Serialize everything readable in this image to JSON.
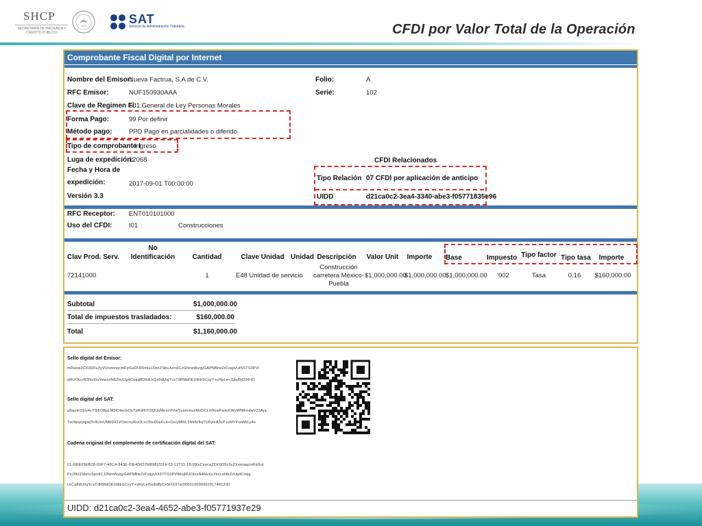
{
  "header": {
    "shcp_title": "SHCP",
    "shcp_sub": "SECRETARÍA DE HACIENDA Y CRÉDITO PÚBLICO",
    "sat_name": "SAT",
    "sat_sub": "Servicio de Administración Tributaria",
    "slide_title": "CFDI por Valor Total de la Operación"
  },
  "invoice": {
    "panel_title": "Comprobante Fiscal Digital por Internet",
    "emisor": {
      "nombre_label": "Nombre del Emisor:",
      "nombre_value": "Nueva Factrua, S.A de C.V.",
      "rfc_label": "RFC Emisor:",
      "rfc_value": "NUF150930AAA",
      "regimen_label": "Clave de Regimen Fi:",
      "regimen_value": "601,General de Ley Personas Morales",
      "forma_label": "Forma Pago:",
      "forma_value": "99 Por definir",
      "metodo_label": "Método pago:",
      "metodo_value": "PPD Pago en parcialidades o diferido",
      "tipo_label": "Tipo de comprobante I",
      "tipo_value": "Ingreso",
      "lugar_label": "Luga de expedición:",
      "lugar_value": "12068",
      "fecha_label1": "Fecha y Hora de",
      "fecha_label2": "expedición:",
      "fecha_value": "2017-09-01 T00:00:00",
      "version_label": "Versión 3.3"
    },
    "folio_label": "Folio:",
    "folio_value": "A",
    "serie_label": "Serie:",
    "serie_value": "102",
    "relacionados": {
      "title": "CFDI Relacionados",
      "tipo_label": "Tipo Relación",
      "tipo_value": "07 CFDI por aplicación de anticipo",
      "uidd_label": "UIDD",
      "uidd_value": "d21ca0c2-3ea4-3340-abe3-f05771835e96"
    },
    "receptor": {
      "rfc_label": "RFC Receptor:",
      "rfc_value": "ENT010101000",
      "uso_label": "Uso del CFDI:",
      "uso_code": "I01",
      "uso_value": "Construcciones"
    },
    "concepts": {
      "headers": [
        "Clav Prod. Serv.",
        "No",
        "Identificación",
        "Cantidad",
        "Clave Unidad",
        "Unidad",
        "Descripción",
        "Valor Unit",
        "Importe",
        "Base",
        "Impuesto",
        "Tipo factor",
        "Tipo tasa",
        "Importe"
      ],
      "row": {
        "clave": "72141000",
        "cantidad": "1",
        "clave_unidad": "E48 Unidad de servicio",
        "desc1": "Construcción",
        "desc2": "carretera México-",
        "desc3": "Puebla",
        "valor_unit": "$1,000,000.00",
        "importe": "$1,000,000.00",
        "base": "$1,000,000.00",
        "impuesto": "'002",
        "tipo_factor": "Tasa",
        "tipo_tasa": "0.16",
        "importe_imp": "$160,000.00"
      }
    },
    "totals": {
      "subtotal_label": "Subtotal",
      "subtotal_value": "$1,000,000.00",
      "impuestos_label": "Total de impuestos trasladados:",
      "impuestos_value": "$160,000.00",
      "total_label": "Total",
      "total_value": "$1,160,000.00"
    }
  },
  "seals": {
    "emisor_label": "Sello digital del Emisor:",
    "emisor_line1": "mRwoe2CK0D0u3yVOnmmqcmFpSuDFR6mlu/J0ti/ZSbvJv/n0CzGNrwWyqyGAPNBhe2rFvqpvUr5STS0PVi",
    "emisor_line2": "qRUOtccN3NvXtvYewcoN6Zm/Ug4Coqg8D6dLkQx0dUsjYcsTdRMd0EUtbbSCsyY+cRpLe+Sjbd9jCt5FIO",
    "sat_label": "Sello digital del SAT:",
    "sat_line1": "uBqom3Slv4cY9j6OBpLMblOlwcbOsTpRdlhYI3QUsMeIoVlVwSyammusMvDCLmNrwFwmKWyWN8mdwV23Ajq",
    "sat_line2": "Tw/4pq/pqjwjTc4UmUMbDiOVOwcoyRoOLvcl5tu00eFLb+Ox/yM0tL3NkN/6qTU6yfxA3cP+vMYPunMtLy4e",
    "cadena_label": "Cadena original del complemento de certificación digital del SAT:",
    "cadena_line1": "||1.0|6E05EB28-09F7-40C4-843E-0IE4D637M898|2014-03-12T15:18:09|sCzecaZCK0D5c9y2XomaqcmFpSuI",
    "cadena_line2": "PsJ0fz2SbnvJqm9CJ0NmWyqyGAPNBleZrFvqpvUt37TO3PVfMvjRUOtcsN4NvXuYevcoNbZvUg4Coqg",
    "cadena_line3": "LkCs8dUtnjYcsTdRMdOEUtbbSCsyY+sRyLeiGzbd8jCx5FIX97e|00001000000201748120||",
    "uidd": "UIDD: d21ca0c2-3ea4-4652-abe3-f05771937e29"
  },
  "colors": {
    "panel_header": "#3f76ae",
    "border_gold": "#d6b949",
    "highlight_red": "#d32a2a",
    "title_dark": "#2d2d2d"
  }
}
